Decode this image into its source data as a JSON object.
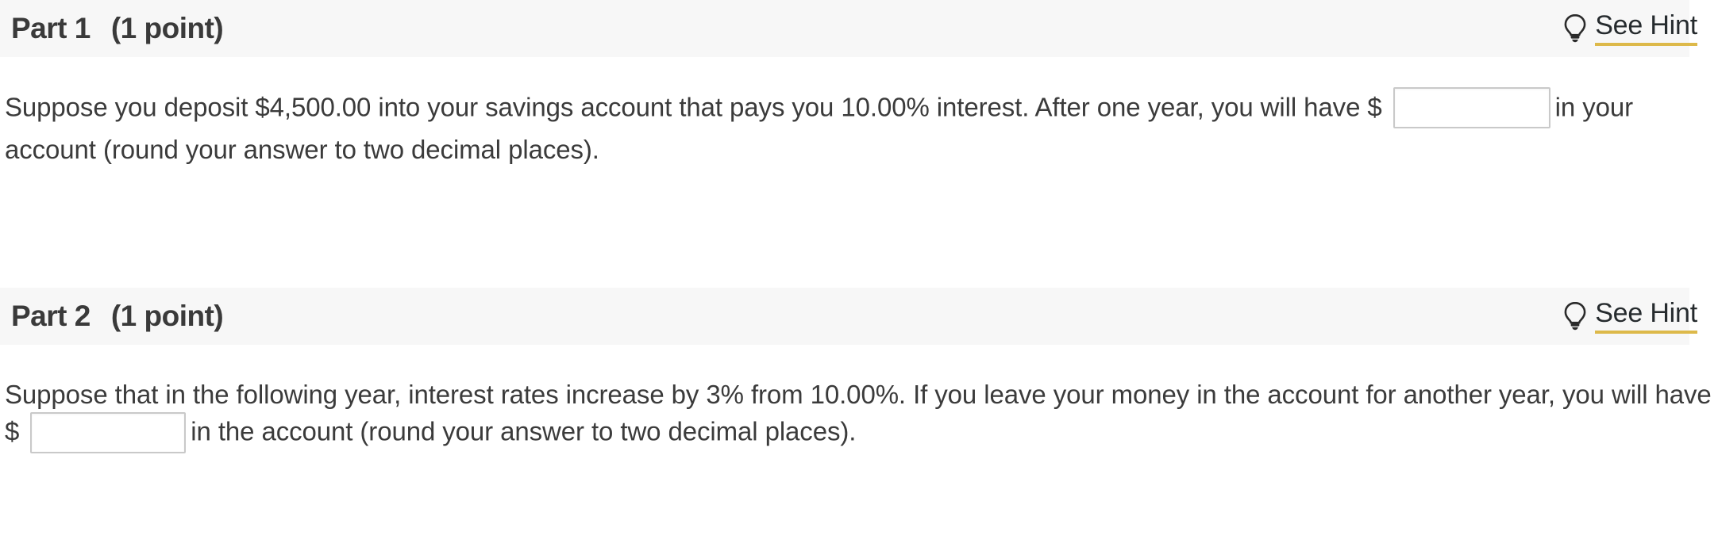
{
  "theme": {
    "header_background": "#f7f7f7",
    "text_color": "#3b3b3b",
    "hint_underline_color": "#ddb94a",
    "input_border_color": "#c9c9c9"
  },
  "parts": [
    {
      "title": "Part 1",
      "points": "(1 point)",
      "hint": {
        "label": "See Hint",
        "icon": "lightbulb-icon"
      },
      "question": {
        "text_before_input": "Suppose you deposit $4,500.00 into your savings account that pays you 10.00% interest. After one year, you will have $",
        "input_value": "",
        "input_placeholder": "",
        "text_after_input": "in your account (round your answer to two decimal places)."
      }
    },
    {
      "title": "Part 2",
      "points": "(1 point)",
      "hint": {
        "label": "See Hint",
        "icon": "lightbulb-icon"
      },
      "question": {
        "text_before_input": "Suppose that in the following year, interest rates increase by 3% from 10.00%. If you leave your money in the account for another year, you will have $",
        "input_value": "",
        "input_placeholder": "",
        "text_after_input": "in the account (round your answer to two decimal places)."
      }
    }
  ]
}
